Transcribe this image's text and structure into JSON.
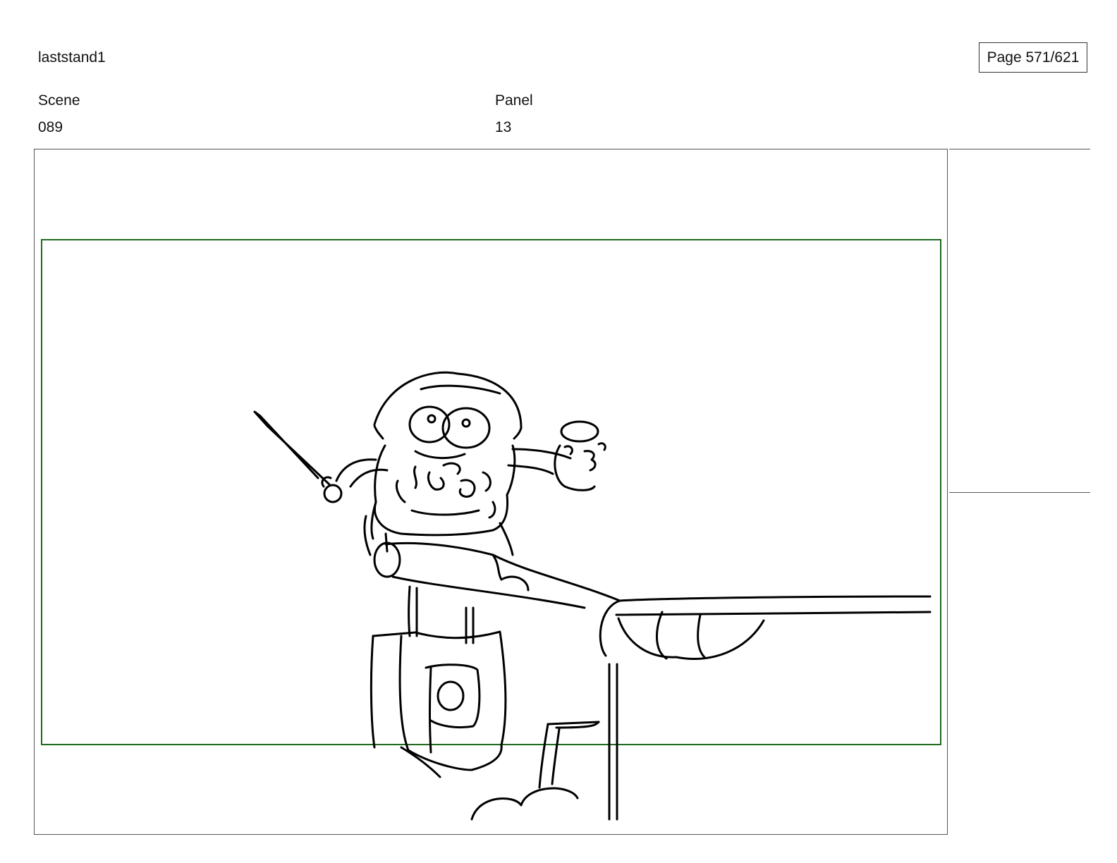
{
  "header": {
    "project_title": "laststand1",
    "page_counter": "Page 571/621"
  },
  "fields": {
    "scene_label": "Scene",
    "scene_value": "089",
    "panel_label": "Panel",
    "panel_value": "13"
  },
  "colors": {
    "safe_area_border": "#1f6b1f",
    "frame_border": "#555555",
    "ink": "#000000"
  }
}
